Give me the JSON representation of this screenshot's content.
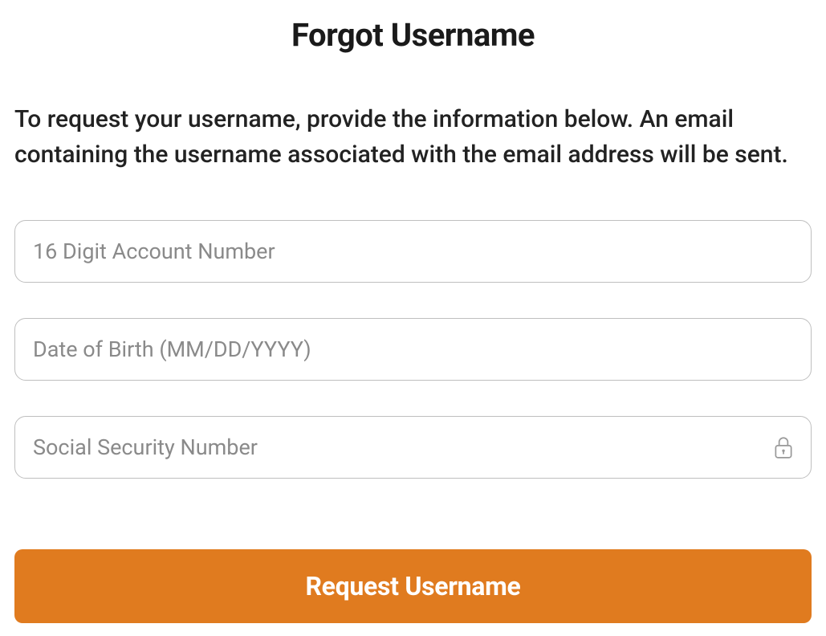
{
  "title": "Forgot Username",
  "instructions": "To request your username, provide the information below. An email containing the username associated with the email address will be sent.",
  "fields": {
    "account_number": {
      "placeholder": "16 Digit Account Number",
      "value": ""
    },
    "date_of_birth": {
      "placeholder": "Date of Birth (MM/DD/YYYY)",
      "value": ""
    },
    "ssn": {
      "placeholder": "Social Security Number",
      "value": ""
    }
  },
  "button": {
    "submit_label": "Request Username"
  },
  "colors": {
    "primary": "#e07b1f",
    "text": "#222222",
    "placeholder": "#8a8a8a",
    "border": "#bfbfbf"
  }
}
